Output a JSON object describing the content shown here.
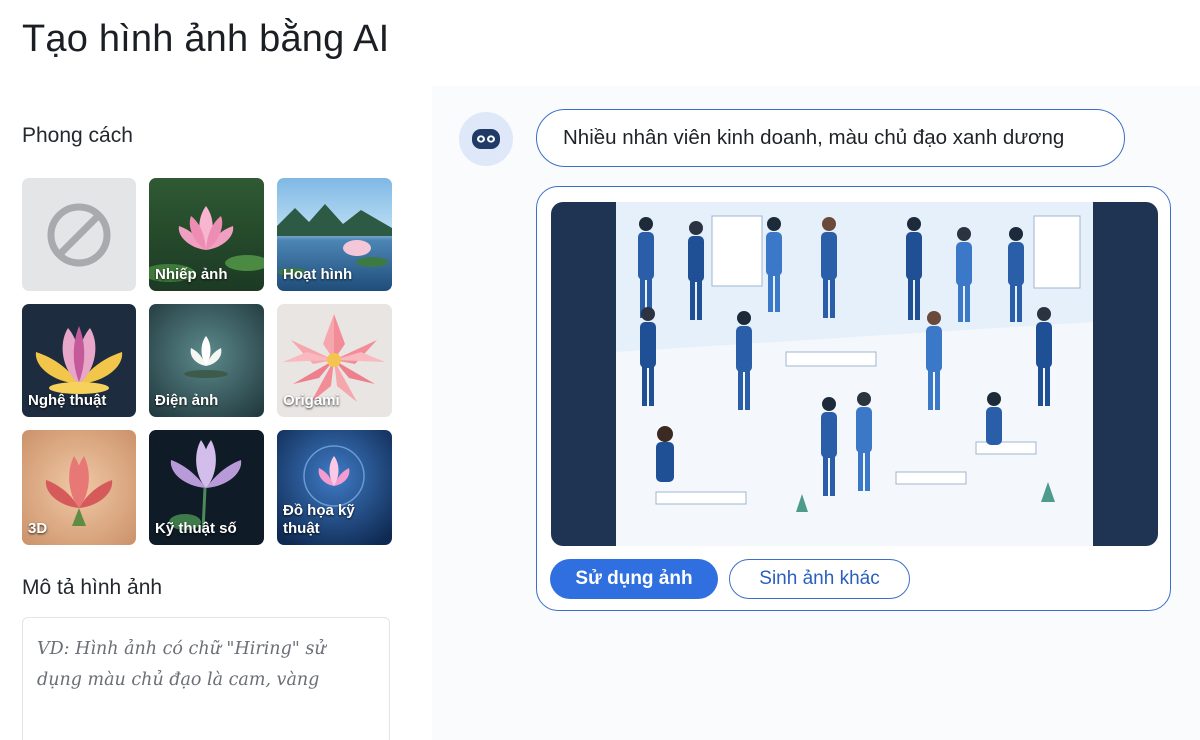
{
  "page": {
    "title": "Tạo hình ảnh bằng AI"
  },
  "style_section": {
    "label": "Phong cách",
    "tiles": [
      {
        "label": "",
        "icon": "no-style-icon"
      },
      {
        "label": "Nhiếp ảnh"
      },
      {
        "label": "Hoạt hình"
      },
      {
        "label": "Nghệ thuật"
      },
      {
        "label": "Điện ảnh"
      },
      {
        "label": "Origami"
      },
      {
        "label": "3D"
      },
      {
        "label": "Kỹ thuật số"
      },
      {
        "label": "Đồ họa kỹ thuật"
      }
    ]
  },
  "description": {
    "label": "Mô tả hình ảnh",
    "placeholder": "VD: Hình ảnh có chữ \"Hiring\" sử dụng màu chủ đạo là cam, vàng"
  },
  "chat": {
    "prompt": "Nhiều nhân viên kinh doanh, màu chủ đạo xanh dương",
    "bot_icon": "robot-icon",
    "buttons": {
      "use_image": "Sử dụng ảnh",
      "regenerate": "Sinh ảnh khác"
    }
  },
  "colors": {
    "accent": "#2f6fe0",
    "border": "#3b6fc9"
  }
}
